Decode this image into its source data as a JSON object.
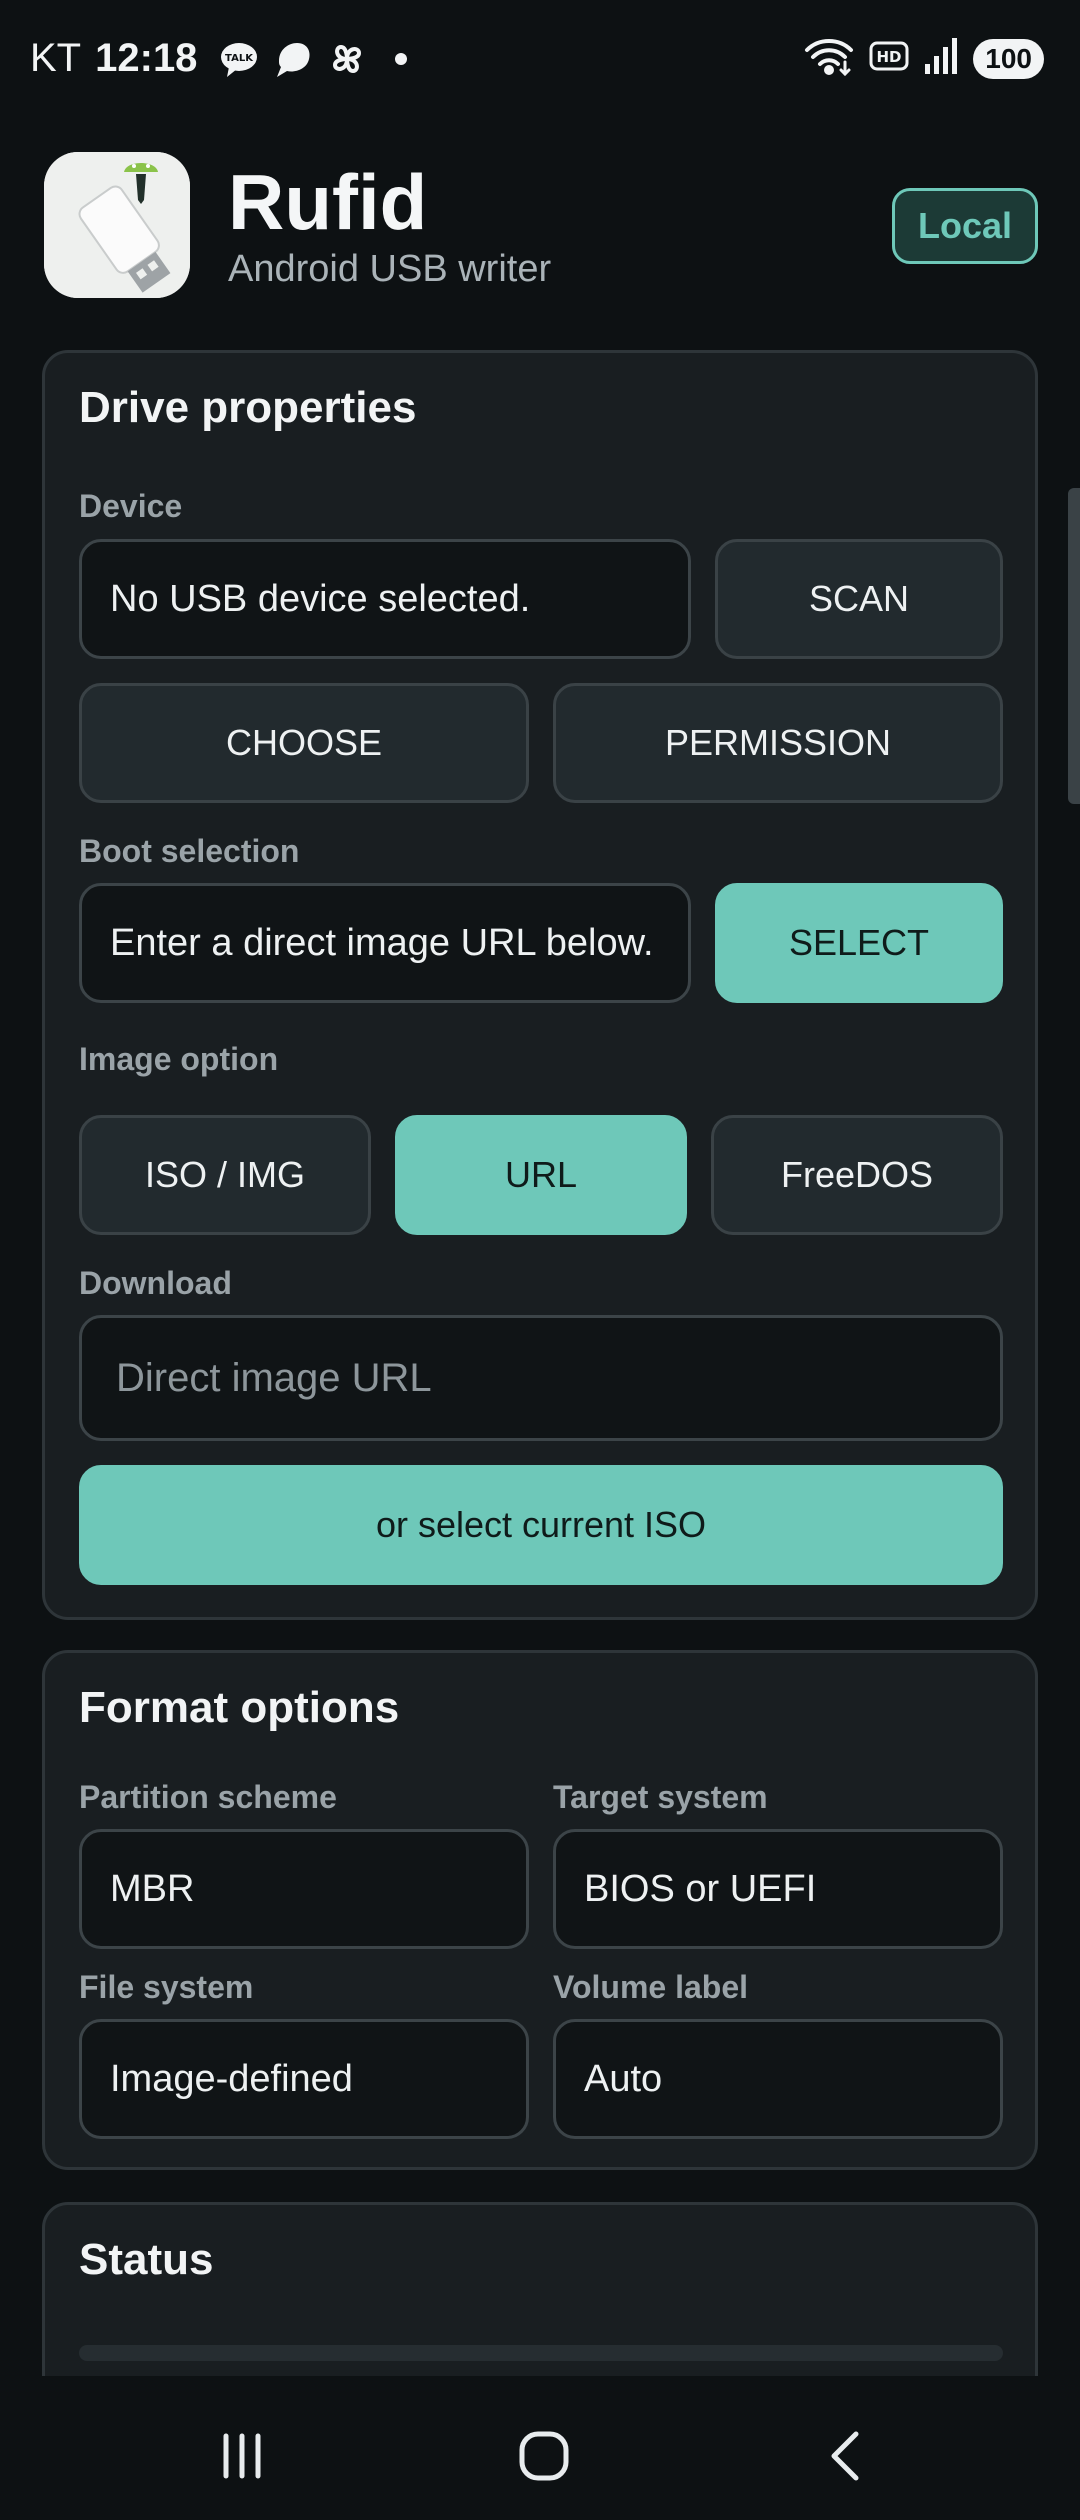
{
  "status_bar": {
    "carrier": "KT",
    "time": "12:18",
    "battery": "100",
    "icons": [
      "talk-icon",
      "chat-bubble-icon",
      "pinwheel-icon",
      "notification-dot",
      "wifi-icon",
      "hd-icon",
      "signal-icon",
      "battery-icon"
    ]
  },
  "header": {
    "title": "Rufid",
    "subtitle": "Android USB writer",
    "badge": "Local",
    "logo_icon": "usb-android-logo"
  },
  "drive_properties": {
    "title": "Drive properties",
    "device_label": "Device",
    "device_value": "No USB device selected.",
    "scan_label": "SCAN",
    "choose_label": "CHOOSE",
    "permission_label": "PERMISSION",
    "boot_label": "Boot selection",
    "boot_value": "Enter a direct image URL below.",
    "select_label": "SELECT",
    "image_option_label": "Image option",
    "image_options": [
      "ISO / IMG",
      "URL",
      "FreeDOS"
    ],
    "image_option_selected": "URL",
    "download_label": "Download",
    "download_placeholder": "Direct image URL",
    "select_current_label": "or select current ISO"
  },
  "format_options": {
    "title": "Format options",
    "partition_label": "Partition scheme",
    "partition_value": "MBR",
    "target_label": "Target system",
    "target_value": "BIOS or UEFI",
    "filesystem_label": "File system",
    "filesystem_value": "Image-defined",
    "volume_label": "Volume label",
    "volume_value": "Auto"
  },
  "status": {
    "title": "Status"
  },
  "colors": {
    "accent": "#6ec8b9",
    "background": "#0d1113",
    "card": "#191e21"
  }
}
